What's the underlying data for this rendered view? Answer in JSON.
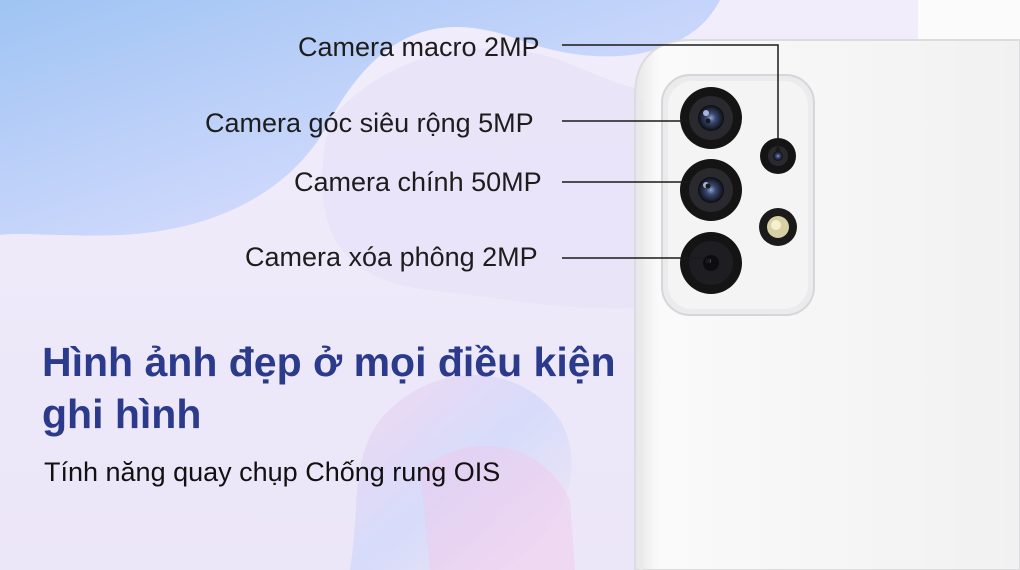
{
  "callouts": {
    "macro": "Camera macro 2MP",
    "ultrawide": "Camera góc siêu rộng 5MP",
    "main": "Camera chính 50MP",
    "depth": "Camera xóa phông 2MP"
  },
  "headline": {
    "line1": "Hình ảnh đẹp ở mọi điều kiện",
    "line2": "ghi hình"
  },
  "subtitle": "Tính năng quay chụp Chống rung OIS",
  "colors": {
    "headline": "#2b3a8a",
    "phone_body": "#f2f2f2",
    "lens_ring": "#1a1a1a"
  }
}
